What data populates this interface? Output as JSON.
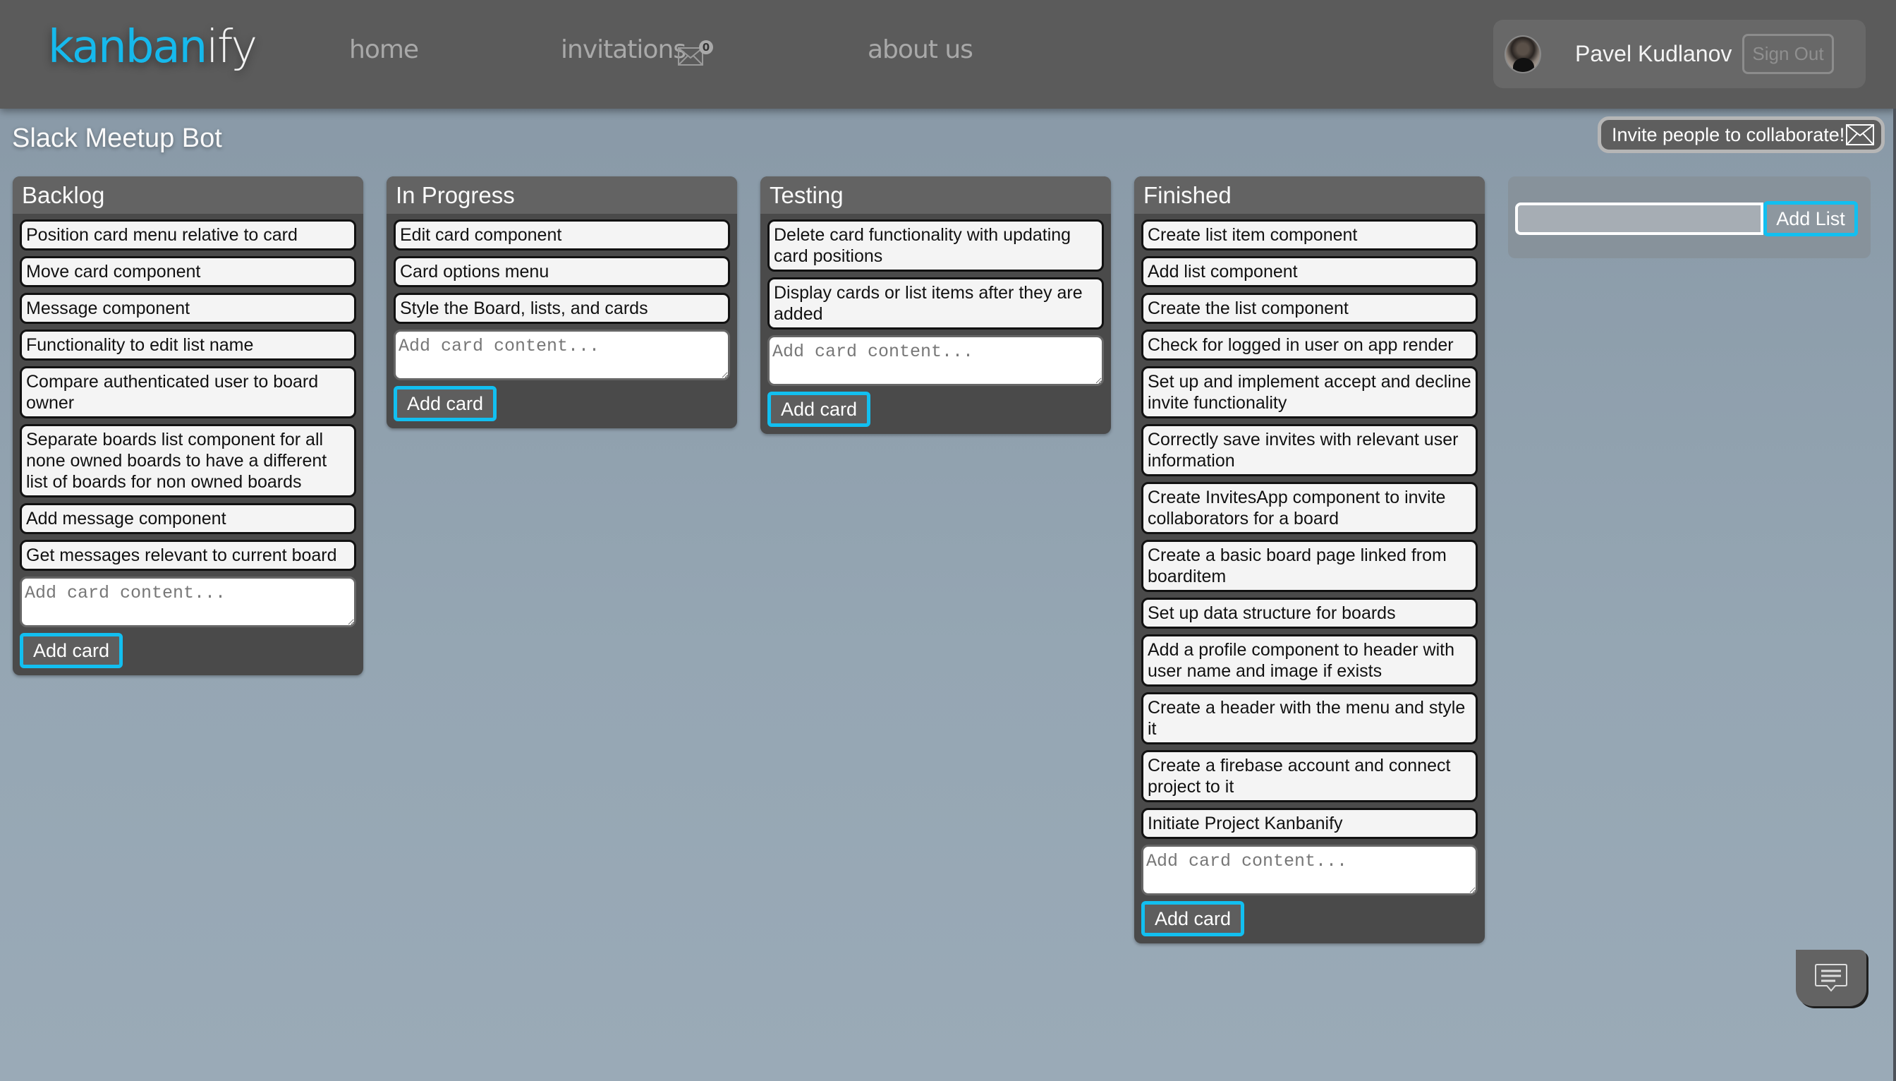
{
  "header": {
    "logo_part1": "kanban",
    "logo_part2": "ify",
    "nav": [
      {
        "label": "home"
      },
      {
        "label": "invitations",
        "badge": "0"
      },
      {
        "label": "about us"
      }
    ],
    "user": {
      "name": "Pavel Kudlanov",
      "signout_label": "Sign Out"
    }
  },
  "board": {
    "title": "Slack Meetup Bot",
    "invite_label": "Invite people to collaborate!",
    "add_card_placeholder": "Add card content...",
    "add_card_label": "Add card",
    "add_list_label": "Add List",
    "add_list_value": ""
  },
  "lists": [
    {
      "title": "Backlog",
      "cards": [
        "Position card menu relative to card",
        "Move card component",
        "Message component",
        "Functionality to edit list name",
        "Compare authenticated user to board owner",
        "Separate boards list component for all none owned boards to have a different list of boards for non owned boards",
        "Add message component",
        "Get messages relevant to current board"
      ]
    },
    {
      "title": "In Progress",
      "cards": [
        "Edit card component",
        "Card options menu",
        "Style the Board, lists, and cards"
      ]
    },
    {
      "title": "Testing",
      "cards": [
        "Delete card functionality with updating card positions",
        "Display cards or list items after they are added"
      ]
    },
    {
      "title": "Finished",
      "cards": [
        "Create list item component",
        "Add list component",
        "Create the list component",
        "Check for logged in user on app render",
        "Set up and implement accept and decline invite functionality",
        "Correctly save invites with relevant user information",
        "Create InvitesApp component to invite collaborators for a board",
        "Create a basic board page linked from boarditem",
        "Set up data structure for boards",
        "Add a profile component to header with user name and image if exists",
        "Create a header with the menu and style it",
        "Create a firebase account and connect project to it",
        "Initiate Project Kanbanify"
      ]
    }
  ],
  "colors": {
    "accent": "#12bff0",
    "header_bg": "#5b5b5b",
    "list_bg": "#4a4a4a",
    "card_bg": "#f4f4f4"
  },
  "icons": {
    "invitations": "envelope-icon",
    "invite": "envelope-icon",
    "chat": "chat-bubble-icon"
  }
}
